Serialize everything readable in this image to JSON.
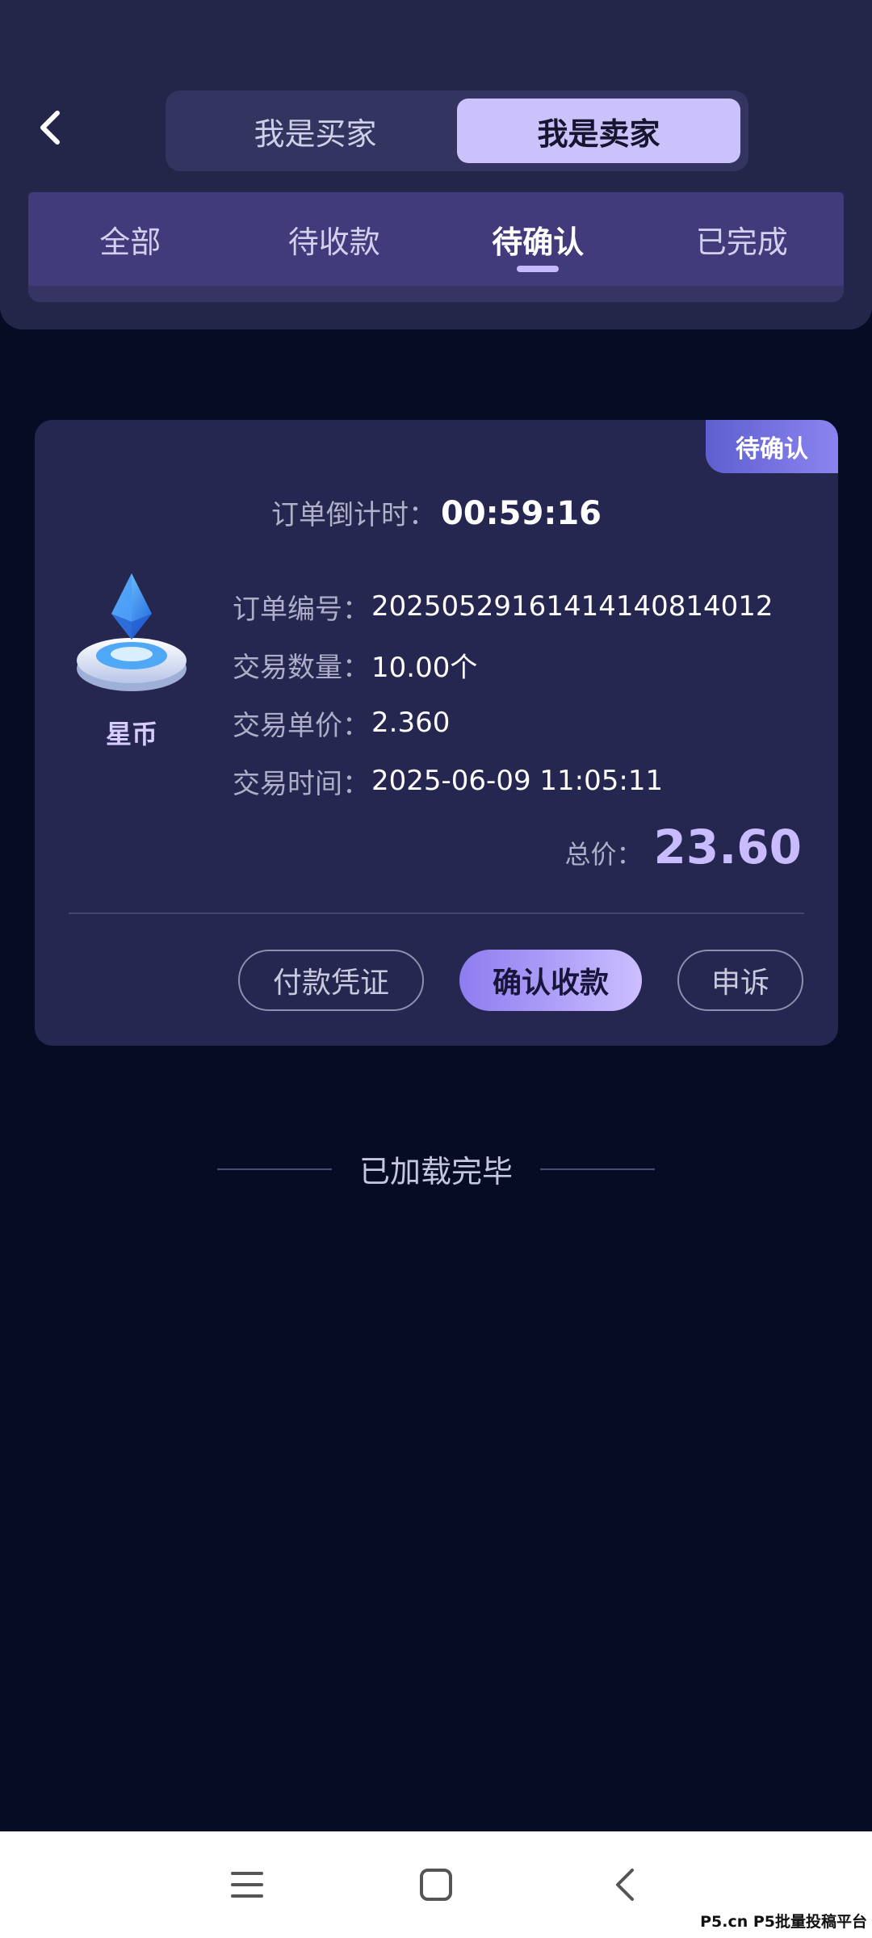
{
  "header": {
    "role_switch": [
      "我是买家",
      "我是卖家"
    ],
    "active_role_index": 1,
    "tabs": [
      "全部",
      "待收款",
      "待确认",
      "已完成"
    ],
    "active_tab_index": 2
  },
  "order": {
    "status_badge": "待确认",
    "countdown_label": "订单倒计时：",
    "countdown_value": "00:59:16",
    "coin_name": "星币",
    "coin_icon": "crystal-coin-icon",
    "fields": [
      {
        "label": "订单编号：",
        "value": "20250529161414140814012"
      },
      {
        "label": "交易数量：",
        "value": "10.00个"
      },
      {
        "label": "交易单价：",
        "value": "2.360"
      },
      {
        "label": "交易时间：",
        "value": "2025-06-09 11:05:11"
      }
    ],
    "total_label": "总价：",
    "total_value": "23.60",
    "actions": {
      "voucher": "付款凭证",
      "confirm": "确认收款",
      "appeal": "申诉"
    }
  },
  "list_end_text": "已加载完毕",
  "system_nav": {
    "icons": [
      "menu-icon",
      "home-icon",
      "back-icon"
    ],
    "watermark": "P5.cn P5批量投稿平台"
  },
  "colors": {
    "page_bg": "#050c24",
    "header_bg": "#232549",
    "tabs_bg": "#413a7b",
    "card_bg": "#262750",
    "accent": "#c8bcff",
    "active_role_bg": "#cbc2fb"
  }
}
